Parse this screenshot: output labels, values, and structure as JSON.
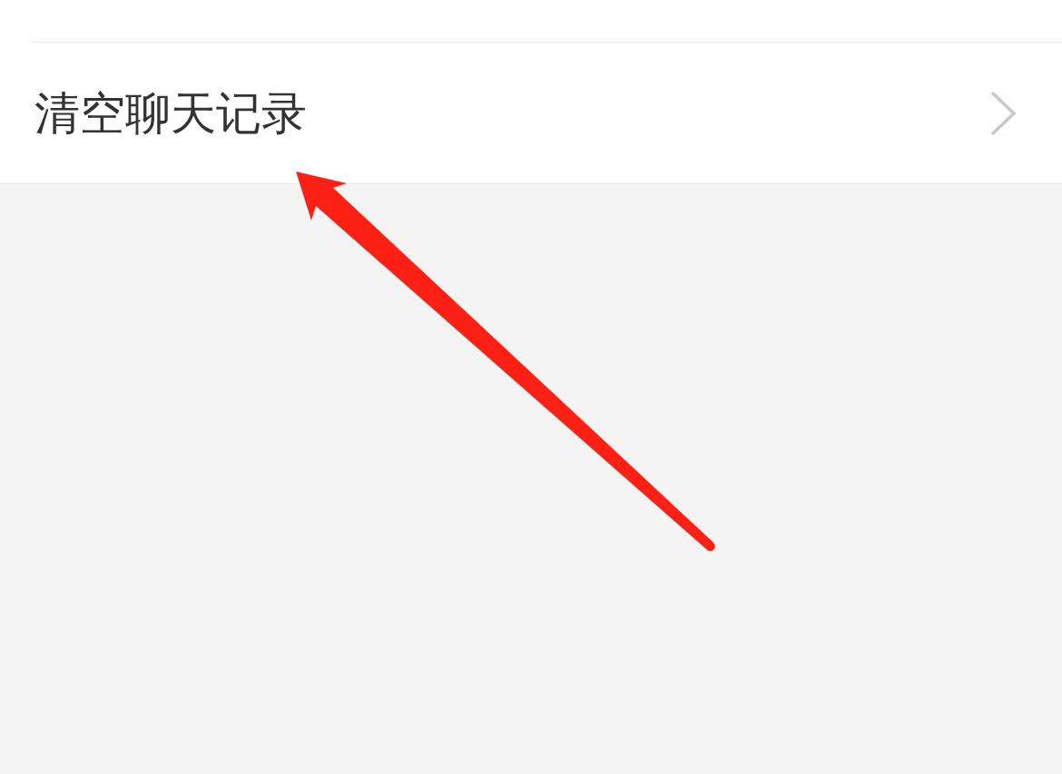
{
  "settings": {
    "items": [
      {
        "label": "清空聊天记录"
      }
    ]
  }
}
